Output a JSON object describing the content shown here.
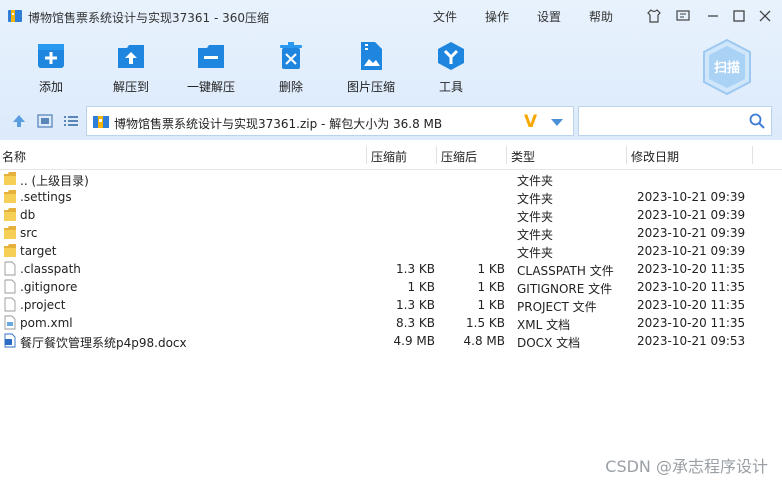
{
  "window": {
    "title": "博物馆售票系统设计与实现37361 - 360压缩",
    "menu": [
      "文件",
      "操作",
      "设置",
      "帮助"
    ]
  },
  "toolbar": {
    "add": "添加",
    "extract_to": "解压到",
    "one_click_extract": "一键解压",
    "delete": "删除",
    "image_compress": "图片压缩",
    "tools": "工具",
    "scan": "扫描"
  },
  "address": {
    "path": "博物馆售票系统设计与实现37361.zip - 解包大小为 36.8 MB",
    "logo": "V"
  },
  "search": {
    "placeholder": ""
  },
  "columns": {
    "name": "名称",
    "compressed": "压缩前",
    "after": "压缩后",
    "type": "类型",
    "modified": "修改日期"
  },
  "files": [
    {
      "name": ".. (上级目录)",
      "before": "",
      "after": "",
      "type": "文件夹",
      "date": "",
      "icon": "folder-icon"
    },
    {
      "name": ".settings",
      "before": "",
      "after": "",
      "type": "文件夹",
      "date": "2023-10-21 09:39",
      "icon": "folder-icon"
    },
    {
      "name": "db",
      "before": "",
      "after": "",
      "type": "文件夹",
      "date": "2023-10-21 09:39",
      "icon": "folder-icon"
    },
    {
      "name": "src",
      "before": "",
      "after": "",
      "type": "文件夹",
      "date": "2023-10-21 09:39",
      "icon": "folder-icon"
    },
    {
      "name": "target",
      "before": "",
      "after": "",
      "type": "文件夹",
      "date": "2023-10-21 09:39",
      "icon": "folder-icon"
    },
    {
      "name": ".classpath",
      "before": "1.3 KB",
      "after": "1 KB",
      "type": "CLASSPATH 文件",
      "date": "2023-10-20 11:35",
      "icon": "file-icon"
    },
    {
      "name": ".gitignore",
      "before": "1 KB",
      "after": "1 KB",
      "type": "GITIGNORE 文件",
      "date": "2023-10-20 11:35",
      "icon": "file-icon"
    },
    {
      "name": ".project",
      "before": "1.3 KB",
      "after": "1 KB",
      "type": "PROJECT 文件",
      "date": "2023-10-20 11:35",
      "icon": "file-icon"
    },
    {
      "name": "pom.xml",
      "before": "8.3 KB",
      "after": "1.5 KB",
      "type": "XML 文档",
      "date": "2023-10-20 11:35",
      "icon": "xml-file-icon"
    },
    {
      "name": "餐厅餐饮管理系统p4p98.docx",
      "before": "4.9 MB",
      "after": "4.8 MB",
      "type": "DOCX 文档",
      "date": "2023-10-21 09:53",
      "icon": "docx-file-icon"
    }
  ],
  "watermark": "CSDN @承志程序设计"
}
